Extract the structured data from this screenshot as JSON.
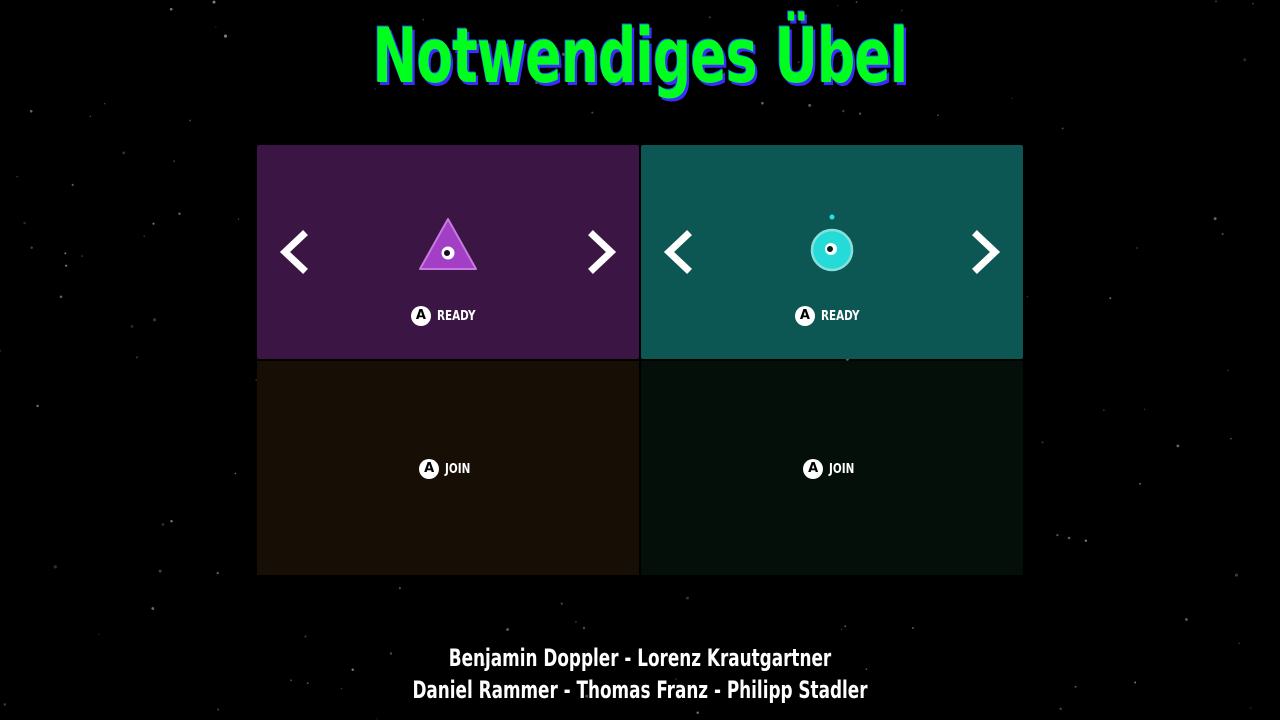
{
  "title": "Notwendiges Übel",
  "colors": {
    "title": "#00ff1e",
    "title_shadow": "#3a2cff",
    "panel_purple": "#3b1544",
    "panel_teal": "#0c5753",
    "panel_brown": "#170e05",
    "panel_green": "#030f08",
    "character_purple": "#a23fc4",
    "character_cyan": "#27e3df"
  },
  "players": [
    {
      "state": "ready",
      "character_icon": "triangle-character-icon",
      "button_glyph": "A",
      "action_label": "READY"
    },
    {
      "state": "ready",
      "character_icon": "circle-character-icon",
      "button_glyph": "A",
      "action_label": "READY"
    },
    {
      "state": "join",
      "button_glyph": "A",
      "action_label": "JOIN"
    },
    {
      "state": "join",
      "button_glyph": "A",
      "action_label": "JOIN"
    }
  ],
  "credits": {
    "line1": "Benjamin Doppler - Lorenz Krautgartner",
    "line2": "Daniel Rammer - Thomas Franz - Philipp Stadler"
  }
}
